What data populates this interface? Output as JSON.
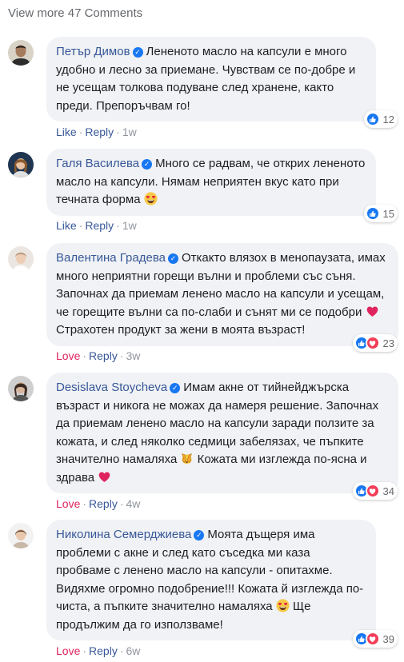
{
  "view_more": "View more 47 Comments",
  "colors": {
    "link": "#385898",
    "love": "#e0245e",
    "bubble": "#f0f2f5",
    "like_icon": "#1877f2",
    "love_icon": "#f33e58"
  },
  "comments": [
    {
      "author": "Петър Димов",
      "text": "Лененото масло на капсули е много удобно и лесно за приемане. Чувствам се по-добре и не усещам толкова подуване след хранене, както преди. Препоръчвам го!",
      "action": "Like",
      "reply": "Reply",
      "time": "1w",
      "reactions": [
        "like-icon"
      ],
      "count": "12"
    },
    {
      "author": "Галя Василева",
      "text": "Много се радвам, че открих лененото масло на капсули. Нямам неприятен вкус като при течната форма",
      "emoji": "heart-eyes-emoji",
      "action": "Like",
      "reply": "Reply",
      "time": "1w",
      "reactions": [
        "like-icon"
      ],
      "count": "15"
    },
    {
      "author": "Валентина Градева",
      "text_a": "Откакто влязох в менопаузата, имах много неприятни горещи вълни и проблеми със съня. Започнах да приемам ленено масло на капсули и усещам, че горещите вълни са по-слаби и сънят ми се подобри",
      "emoji": "red-heart-emoji",
      "text_b": "Страхотен продукт за жени в моята възраст!",
      "action": "Love",
      "reply": "Reply",
      "time": "3w",
      "reactions": [
        "like-icon",
        "love-icon"
      ],
      "count": "23"
    },
    {
      "author": "Desislava Stoycheva",
      "text_a": "Имам акне от тийнейджърска възраст и никога не можах да намеря решение. Започнах да приемам ленено масло на капсули заради ползите за кожата, и след няколко седмици забелязах, че пъпките значително намаляха",
      "emoji": "raising-hands-emoji",
      "text_b": "Кожата ми изглежда по-ясна и здрава",
      "emoji_b": "red-heart-emoji",
      "action": "Love",
      "reply": "Reply",
      "time": "4w",
      "reactions": [
        "like-icon",
        "love-icon"
      ],
      "count": "34"
    },
    {
      "author": "Николина Семерджиева",
      "text_a": "Моята дъщеря има проблеми с акне и след като съседка ми каза пробваме с ленено масло на капсули - опитахме. Видяхме огромно подобрение!!! Кожата й изглежда по-чиста, а пъпките значително намаляха",
      "emoji": "heart-eyes-emoji",
      "text_b": "Ще продължим да го използваме!",
      "action": "Love",
      "reply": "Reply",
      "time": "6w",
      "reactions": [
        "like-icon",
        "love-icon"
      ],
      "count": "39"
    }
  ]
}
